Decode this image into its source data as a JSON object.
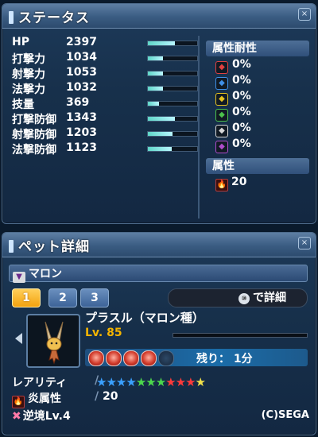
{
  "status_panel": {
    "title": "ステータス",
    "stats": [
      {
        "name": "HP",
        "value": "2397",
        "fill": 0.55
      },
      {
        "name": "打撃力",
        "value": "1034",
        "fill": 0.3
      },
      {
        "name": "射撃力",
        "value": "1053",
        "fill": 0.3
      },
      {
        "name": "法撃力",
        "value": "1032",
        "fill": 0.3
      },
      {
        "name": "技量",
        "value": "369",
        "fill": 0.22
      },
      {
        "name": "打撃防御",
        "value": "1343",
        "fill": 0.55
      },
      {
        "name": "射撃防御",
        "value": "1203",
        "fill": 0.5
      },
      {
        "name": "法撃防御",
        "value": "1123",
        "fill": 0.48
      }
    ],
    "resist_header": "属性耐性",
    "resists": [
      {
        "icon": "fire-resist-icon",
        "value": "0%",
        "color": "#e04040"
      },
      {
        "icon": "ice-resist-icon",
        "value": "0%",
        "color": "#3f8fe6"
      },
      {
        "icon": "lightning-resist-icon",
        "value": "0%",
        "color": "#e6c21e"
      },
      {
        "icon": "wind-resist-icon",
        "value": "0%",
        "color": "#4cc24c"
      },
      {
        "icon": "light-resist-icon",
        "value": "0%",
        "color": "#d8d8d8"
      },
      {
        "icon": "dark-resist-icon",
        "value": "0%",
        "color": "#b04ccc"
      }
    ],
    "attribute_header": "属性",
    "attribute_value": "20"
  },
  "pet_panel": {
    "title": "ペット詳細",
    "pet_label": "マロン",
    "tabs": [
      "1",
      "2",
      "3"
    ],
    "active_tab": 0,
    "detail_label": "で詳細",
    "detail_key": "⑩",
    "pet_name": "プラスル（マロン種）",
    "level": "Lv. 85",
    "level_fill": 0,
    "stones_filled": 4,
    "stones_total": 5,
    "remaining": "残り：  1分",
    "rarity_label": "レアリティ",
    "rarity_stars": 11,
    "star_colors": [
      "#3aa0ff",
      "#3aa0ff",
      "#3aa0ff",
      "#3aa0ff",
      "#4cd84c",
      "#4cd84c",
      "#4cd84c",
      "#ff3a3a",
      "#ff3a3a",
      "#ff3a3a",
      "#f2e14a"
    ],
    "element_label": "炎属性",
    "element_value": "20",
    "trait_label": "逆境Lv.4",
    "copyright": "(C)SEGA"
  }
}
